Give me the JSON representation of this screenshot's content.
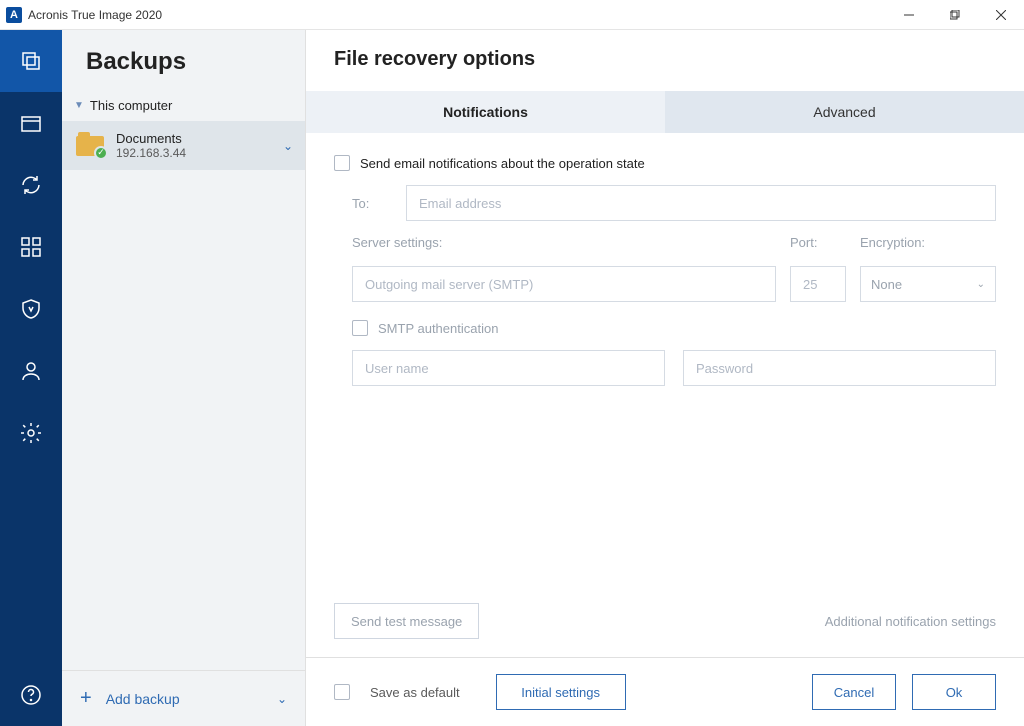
{
  "titlebar": {
    "title": "Acronis True Image 2020",
    "icon_letter": "A"
  },
  "sidebar": {
    "header": "Backups",
    "tree_label": "This computer",
    "item": {
      "name": "Documents",
      "subtitle": "192.168.3.44"
    },
    "add_backup": "Add backup"
  },
  "main": {
    "header": "File recovery options",
    "tabs": {
      "notifications": "Notifications",
      "advanced": "Advanced"
    },
    "send_email_label": "Send email notifications about the operation state",
    "to_label": "To:",
    "email_placeholder": "Email address",
    "server_settings_label": "Server settings:",
    "port_label": "Port:",
    "encryption_label": "Encryption:",
    "smtp_placeholder": "Outgoing mail server (SMTP)",
    "port_value": "25",
    "encryption_value": "None",
    "smtp_auth_label": "SMTP authentication",
    "username_placeholder": "User name",
    "password_placeholder": "Password",
    "send_test_label": "Send test message",
    "additional_link": "Additional notification settings",
    "save_as_default": "Save as default",
    "initial_settings": "Initial settings",
    "cancel": "Cancel",
    "ok": "Ok"
  }
}
